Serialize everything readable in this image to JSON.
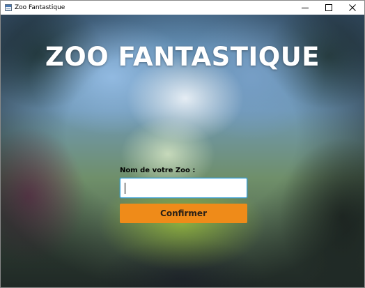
{
  "window": {
    "title": "Zoo Fantastique",
    "controls": [
      "minimize-icon",
      "maximize-icon",
      "close-icon"
    ]
  },
  "main": {
    "heading": "ZOO FANTASTIQUE",
    "name_label": "Nom de votre Zoo :",
    "name_value": "",
    "confirm_label": "Confirmer"
  },
  "colors": {
    "accent_button": "#ef8b19",
    "input_border": "#3aa0d8",
    "heading_text": "#ffffff"
  }
}
